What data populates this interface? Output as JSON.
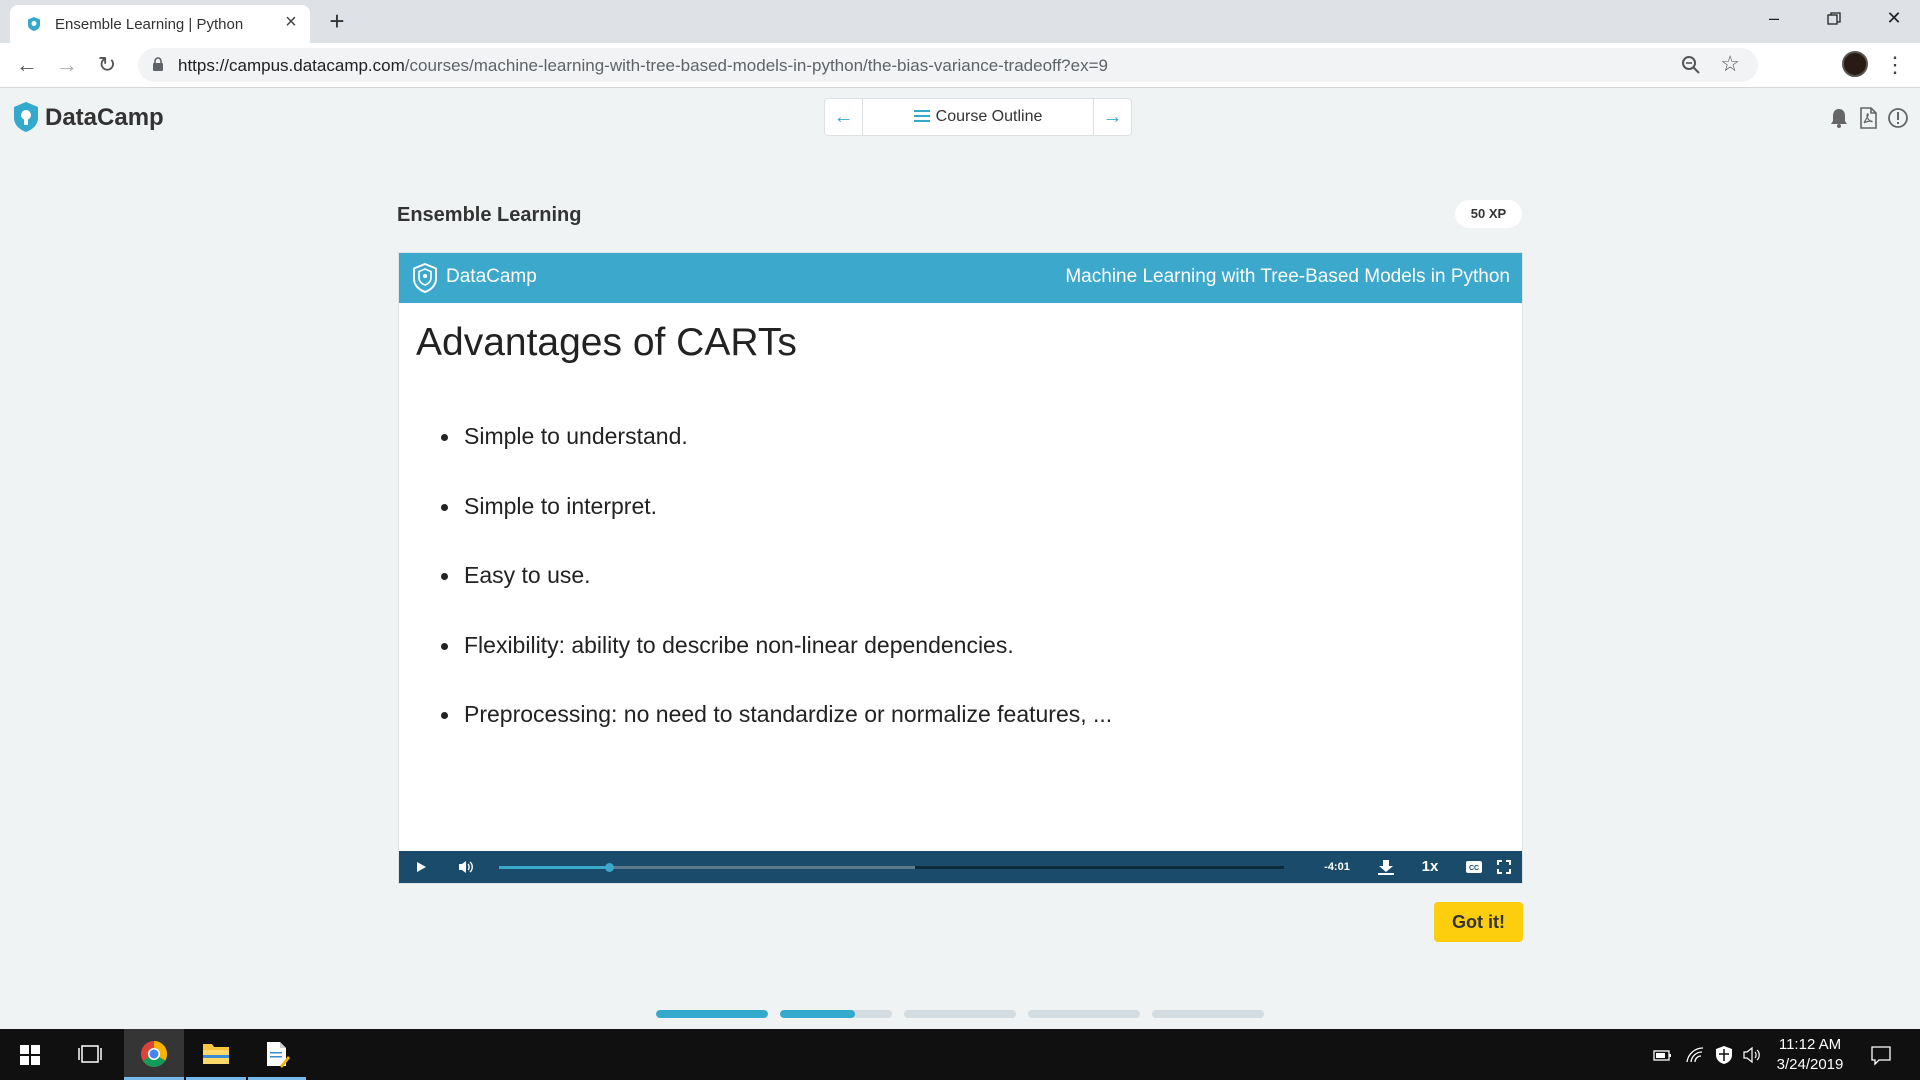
{
  "browser": {
    "tab_title": "Ensemble Learning | Python",
    "new_tab": "+",
    "url_host": "https://campus.datacamp.com",
    "url_path": "/courses/machine-learning-with-tree-based-models-in-python/the-bias-variance-tradeoff?ex=9"
  },
  "header": {
    "brand": "DataCamp",
    "course_outline": "Course Outline"
  },
  "exercise": {
    "title": "Ensemble Learning",
    "xp": "50 XP"
  },
  "slide": {
    "brand": "DataCamp",
    "course": "Machine Learning with Tree-Based Models in Python",
    "heading": "Advantages of CARTs",
    "bullets": [
      "Simple to understand.",
      "Simple to interpret.",
      "Easy to use.",
      "Flexibility: ability to describe non-linear dependencies.",
      "Preprocessing: no need to standardize or normalize features, ..."
    ]
  },
  "player": {
    "time_remaining": "-4:01",
    "speed": "1x",
    "progress_played": 0.14,
    "progress_buffered": 0.53
  },
  "actions": {
    "got_it": "Got it!"
  },
  "lesson_steps": [
    1.0,
    0.67,
    0.0,
    0.0,
    0.0
  ],
  "taskbar": {
    "time": "11:12 AM",
    "date": "3/24/2019"
  },
  "colors": {
    "accent": "#33aacc",
    "slide_header": "#3ba8cc",
    "player_bar": "#1b4b6b",
    "got_it": "#fcce0d"
  }
}
